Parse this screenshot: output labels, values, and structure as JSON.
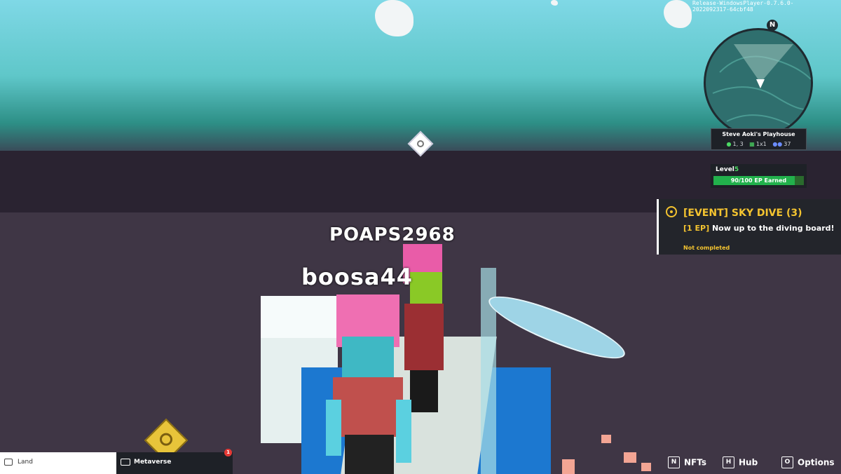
{
  "build_label": "Release-WindowsPlayer-0.7.6.0-2022092317-64cbf48",
  "minimap": {
    "north": "N",
    "land_name": "Steve Aoki's Playhouse",
    "coords": "1, 3",
    "size": "1x1",
    "players": "37",
    "icons": {
      "coords": "pin-icon",
      "size": "grid-icon",
      "players": "people-icon"
    }
  },
  "level": {
    "label": "Level",
    "value": "5",
    "progress_text": "90/100  EP Earned",
    "progress": 0.9
  },
  "quest": {
    "title": "[EVENT] SKY DIVE (3)",
    "ep": "[1 EP]",
    "description": "Now up to the diving board!",
    "status": "Not completed"
  },
  "players": [
    {
      "name": "POAPS2968"
    },
    {
      "name": "boosa44"
    }
  ],
  "chat": {
    "land_label": "Land",
    "metaverse_label": "Metaverse",
    "unread": "1"
  },
  "shortcuts": [
    {
      "key": "N",
      "label": "NFTs"
    },
    {
      "key": "H",
      "label": "Hub"
    },
    {
      "key": "O",
      "label": "Options"
    }
  ],
  "colors": {
    "accent": "#f4c430",
    "progress": "#22b14c",
    "level": "#4cd964"
  }
}
